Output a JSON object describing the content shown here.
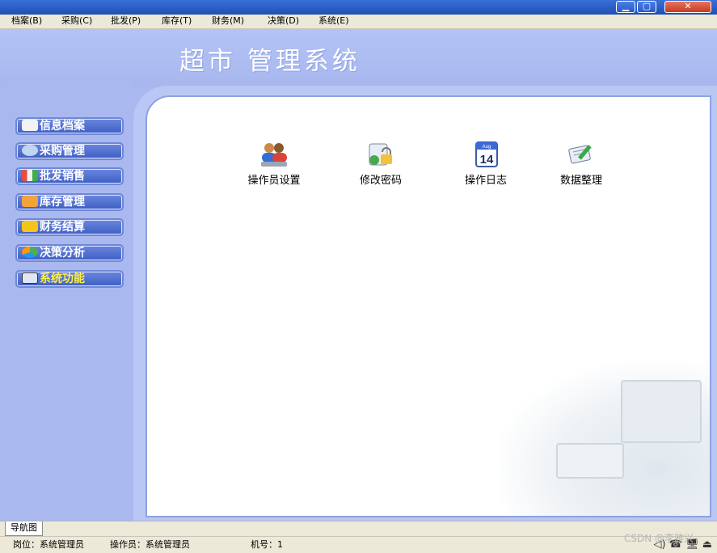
{
  "menu": [
    "档案(B)",
    "采购(C)",
    "批发(P)",
    "库存(T)",
    "财务(M)",
    "决策(D)",
    "系统(E)"
  ],
  "window_controls": {
    "minimize": "▁",
    "maximize": "▢",
    "close": "✕"
  },
  "app_title": "超市 管理系统",
  "sidebar": [
    {
      "label": "信息档案",
      "icon": "book-icon"
    },
    {
      "label": "采购管理",
      "icon": "magnifier-icon"
    },
    {
      "label": "批发销售",
      "icon": "sales-chart-icon"
    },
    {
      "label": "库存管理",
      "icon": "box-icon"
    },
    {
      "label": "财务结算",
      "icon": "money-icon"
    },
    {
      "label": "决策分析",
      "icon": "pie-chart-icon"
    },
    {
      "label": "系统功能",
      "icon": "computer-icon"
    }
  ],
  "functions": [
    {
      "label": "操作员设置",
      "icon": "users-icon"
    },
    {
      "label": "修改密码",
      "icon": "lock-icon"
    },
    {
      "label": "操作日志",
      "icon": "calendar-icon"
    },
    {
      "label": "数据整理",
      "icon": "edit-icon"
    }
  ],
  "calendar_icon": {
    "month": "Aug",
    "day": "14"
  },
  "tab": "导航图",
  "status": {
    "position": "岗位：系统管理员",
    "operator": "操作员：系统管理员",
    "machine": "机号：1"
  },
  "tray": "◁) ☎ 🖥 ⏏",
  "watermark": "CSDN @李雅兴",
  "colors": {
    "titlebar": "#2a5cc8",
    "app_bg": "#a9b8ef",
    "nav_button": "#4f6fd0",
    "system_label": "#ffef40"
  }
}
